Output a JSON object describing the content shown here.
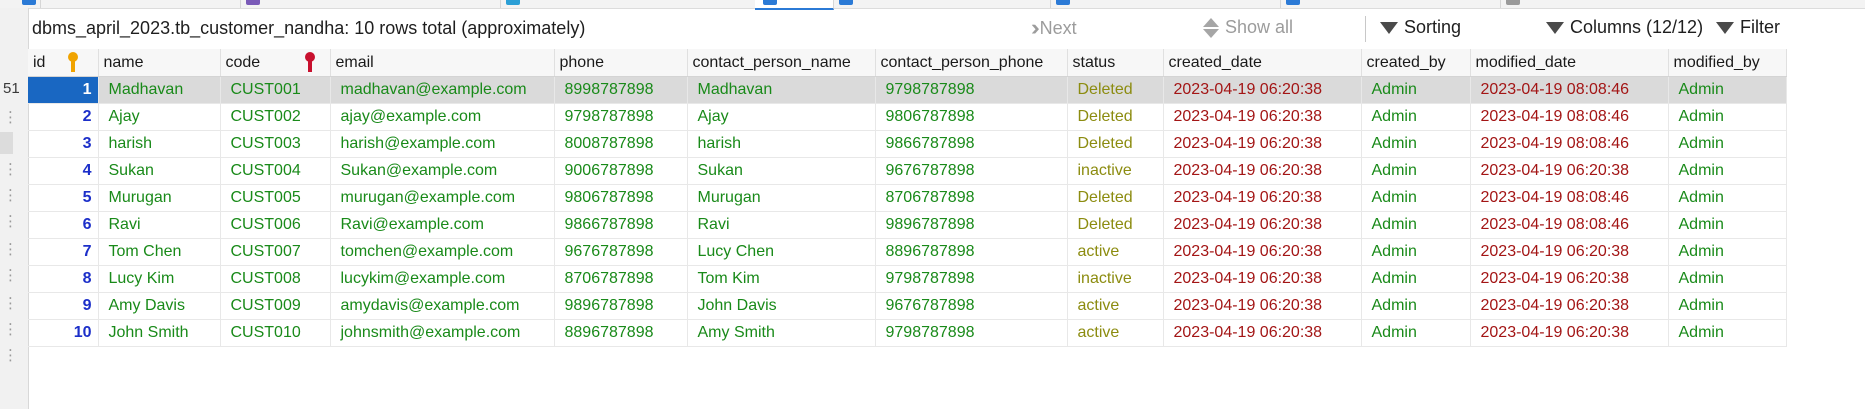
{
  "summary": "dbms_april_2023.tb_customer_nandha: 10 rows total (approximately)",
  "toolbar": {
    "next_label": "Next",
    "show_all_label": "Show all",
    "sorting_label": "Sorting",
    "columns_label": "Columns (12/12)",
    "filter_label": "Filter"
  },
  "gutter": {
    "line_top": "51"
  },
  "columns": [
    "id",
    "name",
    "code",
    "email",
    "phone",
    "contact_person_name",
    "contact_person_phone",
    "status",
    "created_date",
    "created_by",
    "modified_date",
    "modified_by"
  ],
  "rows": [
    {
      "id": "1",
      "name": "Madhavan",
      "code": "CUST001",
      "email": "madhavan@example.com",
      "phone": "8998787898",
      "contact_person_name": "Madhavan",
      "contact_person_phone": "9798787898",
      "status": "Deleted",
      "created_date": "2023-04-19 06:20:38",
      "created_by": "Admin",
      "modified_date": "2023-04-19 08:08:46",
      "modified_by": "Admin"
    },
    {
      "id": "2",
      "name": "Ajay",
      "code": "CUST002",
      "email": "ajay@example.com",
      "phone": "9798787898",
      "contact_person_name": "Ajay",
      "contact_person_phone": "9806787898",
      "status": "Deleted",
      "created_date": "2023-04-19 06:20:38",
      "created_by": "Admin",
      "modified_date": "2023-04-19 08:08:46",
      "modified_by": "Admin"
    },
    {
      "id": "3",
      "name": "harish",
      "code": "CUST003",
      "email": "harish@example.com",
      "phone": "8008787898",
      "contact_person_name": "harish",
      "contact_person_phone": "9866787898",
      "status": "Deleted",
      "created_date": "2023-04-19 06:20:38",
      "created_by": "Admin",
      "modified_date": "2023-04-19 08:08:46",
      "modified_by": "Admin"
    },
    {
      "id": "4",
      "name": "Sukan",
      "code": "CUST004",
      "email": "Sukan@example.com",
      "phone": "9006787898",
      "contact_person_name": "Sukan",
      "contact_person_phone": "9676787898",
      "status": "inactive",
      "created_date": "2023-04-19 06:20:38",
      "created_by": "Admin",
      "modified_date": "2023-04-19 06:20:38",
      "modified_by": "Admin"
    },
    {
      "id": "5",
      "name": "Murugan",
      "code": "CUST005",
      "email": "murugan@example.com",
      "phone": "9806787898",
      "contact_person_name": "Murugan",
      "contact_person_phone": "8706787898",
      "status": "Deleted",
      "created_date": "2023-04-19 06:20:38",
      "created_by": "Admin",
      "modified_date": "2023-04-19 08:08:46",
      "modified_by": "Admin"
    },
    {
      "id": "6",
      "name": "Ravi",
      "code": "CUST006",
      "email": "Ravi@example.com",
      "phone": "9866787898",
      "contact_person_name": "Ravi",
      "contact_person_phone": "9896787898",
      "status": "Deleted",
      "created_date": "2023-04-19 06:20:38",
      "created_by": "Admin",
      "modified_date": "2023-04-19 08:08:46",
      "modified_by": "Admin"
    },
    {
      "id": "7",
      "name": "Tom Chen",
      "code": "CUST007",
      "email": "tomchen@example.com",
      "phone": "9676787898",
      "contact_person_name": "Lucy Chen",
      "contact_person_phone": "8896787898",
      "status": "active",
      "created_date": "2023-04-19 06:20:38",
      "created_by": "Admin",
      "modified_date": "2023-04-19 06:20:38",
      "modified_by": "Admin"
    },
    {
      "id": "8",
      "name": "Lucy Kim",
      "code": "CUST008",
      "email": "lucykim@example.com",
      "phone": "8706787898",
      "contact_person_name": "Tom Kim",
      "contact_person_phone": "9798787898",
      "status": "inactive",
      "created_date": "2023-04-19 06:20:38",
      "created_by": "Admin",
      "modified_date": "2023-04-19 06:20:38",
      "modified_by": "Admin"
    },
    {
      "id": "9",
      "name": "Amy Davis",
      "code": "CUST009",
      "email": "amydavis@example.com",
      "phone": "9896787898",
      "contact_person_name": "John Davis",
      "contact_person_phone": "9676787898",
      "status": "active",
      "created_date": "2023-04-19 06:20:38",
      "created_by": "Admin",
      "modified_date": "2023-04-19 06:20:38",
      "modified_by": "Admin"
    },
    {
      "id": "10",
      "name": "John Smith",
      "code": "CUST010",
      "email": "johnsmith@example.com",
      "phone": "8896787898",
      "contact_person_name": "Amy Smith",
      "contact_person_phone": "9798787898",
      "status": "active",
      "created_date": "2023-04-19 06:20:38",
      "created_by": "Admin",
      "modified_date": "2023-04-19 06:20:38",
      "modified_by": "Admin"
    }
  ],
  "selected_row": 1,
  "icons": {
    "primary_key": "key-icon",
    "unique_key": "key-icon",
    "sort": "sort-icon",
    "columns": "columns-icon",
    "filter": "filter-icon",
    "next": "double-chevron-icon"
  },
  "colors": {
    "id_text": "#1c2fc9",
    "value_text": "#198a19",
    "status_text": "#8c8c10",
    "date_text": "#a31515",
    "selected_id_bg": "#1967c2",
    "selected_row_bg": "#dadada",
    "primary_key": "#f0a300",
    "unique_key": "#c8102e"
  }
}
